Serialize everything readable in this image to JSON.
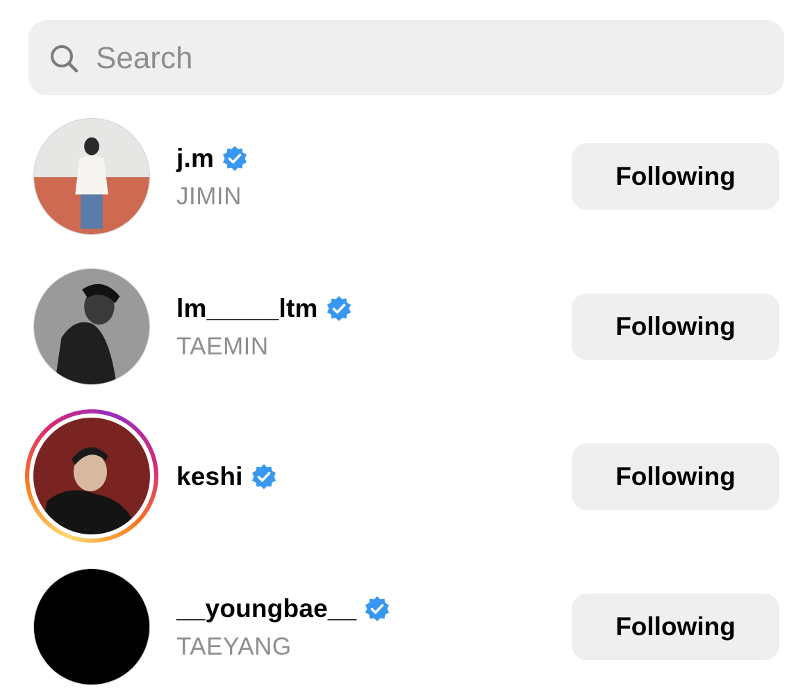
{
  "search": {
    "placeholder": "Search",
    "icon": "search-icon"
  },
  "accounts": [
    {
      "username": "j.m",
      "name": "JIMIN",
      "verified": true,
      "button": "Following"
    },
    {
      "username": "lm_____ltm",
      "name": "TAEMIN",
      "verified": true,
      "button": "Following"
    },
    {
      "username": "keshi",
      "name": "",
      "verified": true,
      "button": "Following",
      "story_ring": true
    },
    {
      "username": "__youngbae__",
      "name": "TAEYANG",
      "verified": true,
      "button": "Following"
    }
  ],
  "colors": {
    "verified": "#3897f0",
    "secondary_text": "#8e8e8e",
    "button_bg": "#efefef"
  }
}
